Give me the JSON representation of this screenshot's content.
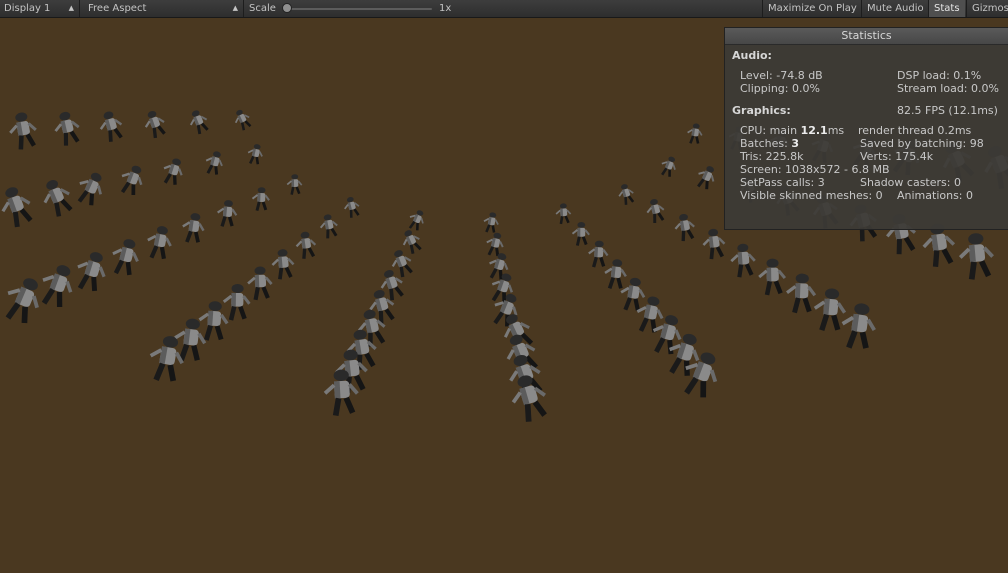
{
  "toolbar": {
    "display": "Display 1",
    "aspect": "Free Aspect",
    "scale_label": "Scale",
    "scale_value": "1x",
    "maximize_on_play": "Maximize On Play",
    "mute_audio": "Mute Audio",
    "stats": "Stats",
    "gizmos": "Gizmos"
  },
  "colors": {
    "ground": "#4a3820",
    "toolbar": "#353535",
    "panel": "#3c3a36",
    "active_button": "#4f4f4f"
  },
  "stats": {
    "title": "Statistics",
    "audio_heading": "Audio:",
    "level": "Level: -74.8 dB",
    "dsp_load": "DSP load: 0.1%",
    "clipping": "Clipping: 0.0%",
    "stream_load": "Stream load: 0.0%",
    "graphics_heading": "Graphics:",
    "fps": "82.5 FPS (12.1ms)",
    "cpu_prefix": "CPU: main ",
    "cpu_main": "12.1",
    "cpu_suffix": "ms",
    "render_thread": "render thread 0.2ms",
    "batches_prefix": "Batches: ",
    "batches": "3",
    "saved_by_batching": "Saved by batching: 98",
    "tris": "Tris: 225.8k",
    "verts": "Verts: 175.4k",
    "screen": "Screen: 1038x572 - 6.8 MB",
    "setpass": "SetPass calls: 3",
    "shadow_casters": "Shadow casters: 0",
    "visible_skinned": "Visible skinned meshes: 0",
    "animations": "Animations: 0"
  }
}
